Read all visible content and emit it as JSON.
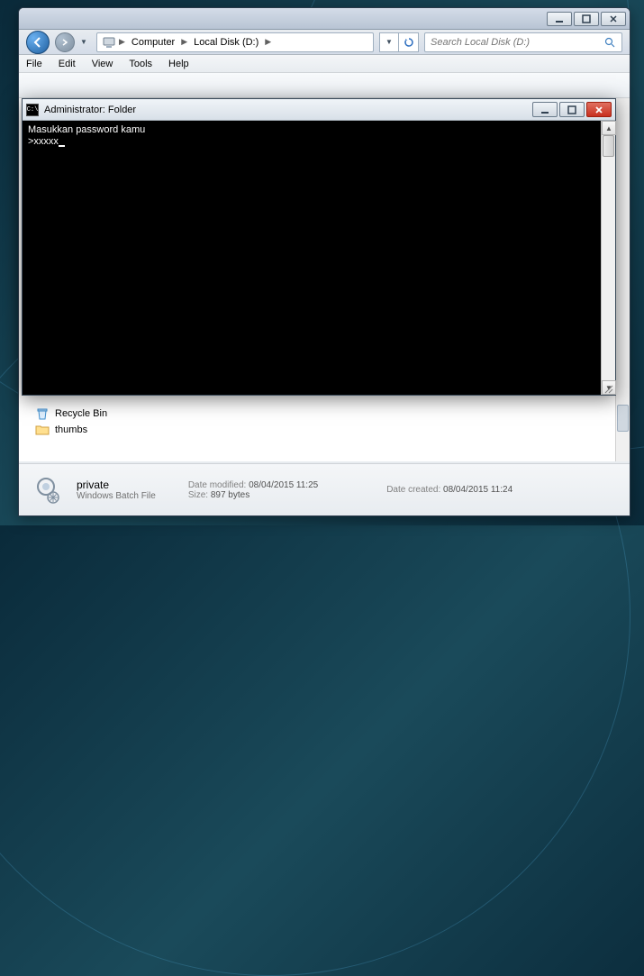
{
  "explorer": {
    "breadcrumb": {
      "root": "Computer",
      "drive": "Local Disk (D:)"
    },
    "search_placeholder": "Search Local Disk (D:)",
    "menu": {
      "file": "File",
      "edit": "Edit",
      "view": "View",
      "tools": "Tools",
      "help": "Help"
    },
    "files": {
      "recycle": "Recycle Bin",
      "thumbs": "thumbs"
    },
    "details": {
      "name": "private",
      "type": "Windows Batch File",
      "modified_label": "Date modified:",
      "modified": "08/04/2015 11:25",
      "size_label": "Size:",
      "size": "897 bytes",
      "created_label": "Date created:",
      "created": "08/04/2015 11:24"
    }
  },
  "cmd": {
    "title": "Administrator:  Folder",
    "icon_text": "C:\\",
    "line1": "Masukkan password kamu",
    "line2": ">xxxxx"
  }
}
